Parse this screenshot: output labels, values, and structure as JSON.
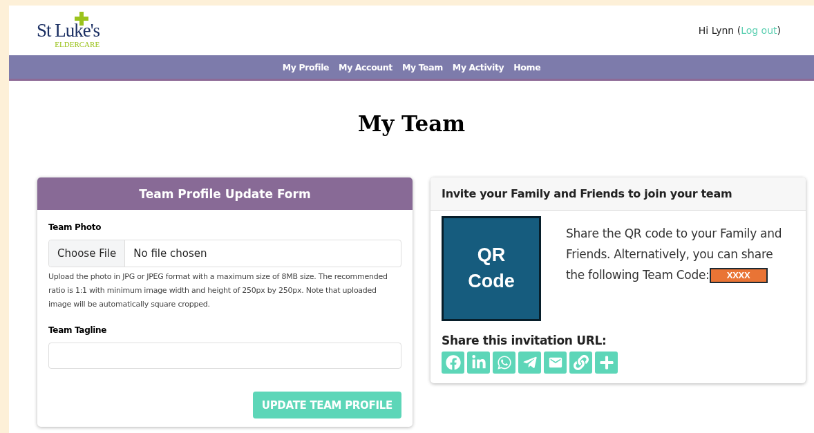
{
  "header": {
    "logo": {
      "name": "St Luke's",
      "sub": "ELDERCARE"
    },
    "greeting": "Hi Lynn (",
    "logout": "Log out",
    "greeting_end": ")"
  },
  "nav": [
    "My Profile",
    "My Account",
    "My Team",
    "My Activity",
    "Home"
  ],
  "page_title": "My Team",
  "form": {
    "title": "Team Profile Update Form",
    "photo_label": "Team Photo",
    "choose_button": "Choose File",
    "file_status": "No file chosen",
    "help": "Upload the photo in JPG or JPEG format with a maximum size of 8MB size. The recommended ratio is 1:1 with minimum image width and height of 250px by 250px. Note that uploaded image will be automatically square cropped.",
    "tagline_label": "Team Tagline",
    "submit": "UPDATE TEAM PROFILE"
  },
  "invite": {
    "title": "Invite your Family and Friends to join your team",
    "qr": "QR Code",
    "text": "Share the QR code to your Family and Friends. Alternatively, you can share the following Team Code:",
    "code": "XXXX",
    "share_label": "Share this invitation URL:"
  }
}
